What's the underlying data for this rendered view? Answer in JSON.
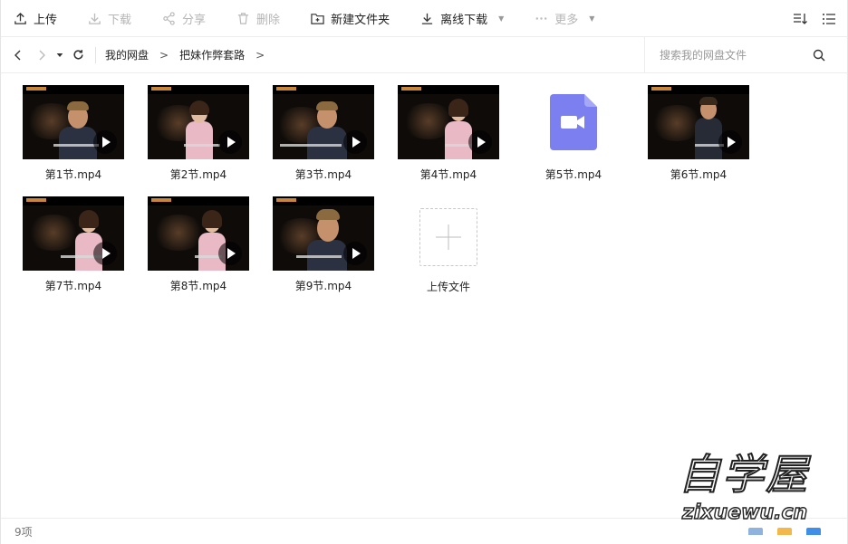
{
  "toolbar": {
    "upload": "上传",
    "download": "下载",
    "share": "分享",
    "delete": "删除",
    "new_folder": "新建文件夹",
    "offline_download": "离线下载",
    "more": "更多"
  },
  "breadcrumb": {
    "root": "我的网盘",
    "folder": "把妹作弊套路",
    "separator": ">"
  },
  "search": {
    "placeholder": "搜索我的网盘文件"
  },
  "files": [
    {
      "name": "第1节.mp4"
    },
    {
      "name": "第2节.mp4"
    },
    {
      "name": "第3节.mp4"
    },
    {
      "name": "第4节.mp4"
    },
    {
      "name": "第5节.mp4"
    },
    {
      "name": "第6节.mp4"
    },
    {
      "name": "第7节.mp4"
    },
    {
      "name": "第8节.mp4"
    },
    {
      "name": "第9节.mp4"
    }
  ],
  "upload_tile": {
    "label": "上传文件"
  },
  "status": {
    "count": "9项"
  },
  "watermark": {
    "main": "自学屋",
    "sub": "zixuewu.cn"
  },
  "colors": {
    "video_icon": "#7b7ff0",
    "accent_gold": "#c9853a"
  }
}
